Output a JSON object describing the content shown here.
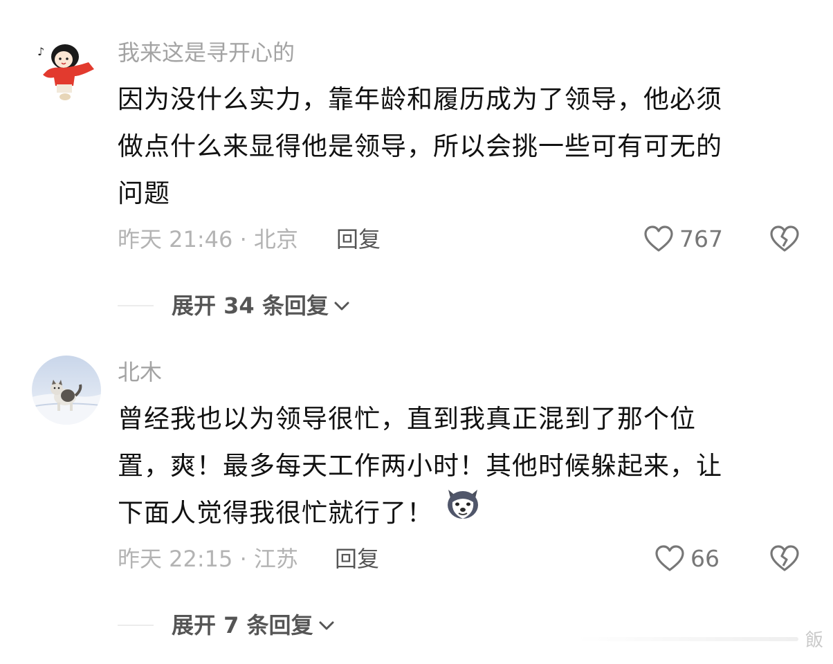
{
  "comments": [
    {
      "username": "我来这是寻开心的",
      "body_lines": [
        "因为没什么实力，靠年龄和履历成为了领导，他必须",
        "做点什么来显得他是领导，所以会挑一些可有可无的",
        "问题"
      ],
      "time_location": "昨天 21:46 · 北京",
      "reply_label": "回复",
      "like_count": "767",
      "expand_label": "展开 34 条回复",
      "avatar_icon": "cartoon-girl-avatar"
    },
    {
      "username": "北木",
      "body_lines": [
        "曾经我也以为领导很忙，直到我真正混到了那个位",
        "置，爽！最多每天工作两小时！其他时候躲起来，让",
        "下面人觉得我很忙就行了！"
      ],
      "time_location": "昨天 22:15 · 江苏",
      "reply_label": "回复",
      "like_count": "66",
      "expand_label": "展开 7 条回复",
      "avatar_icon": "cat-in-snow-avatar",
      "inline_emoji": "husky-dog-emoji"
    }
  ],
  "watermark": {
    "text": "飯"
  },
  "colors": {
    "username": "#a3a3a3",
    "body": "#111111",
    "meta": "#b3b3b3",
    "action": "#555555"
  }
}
